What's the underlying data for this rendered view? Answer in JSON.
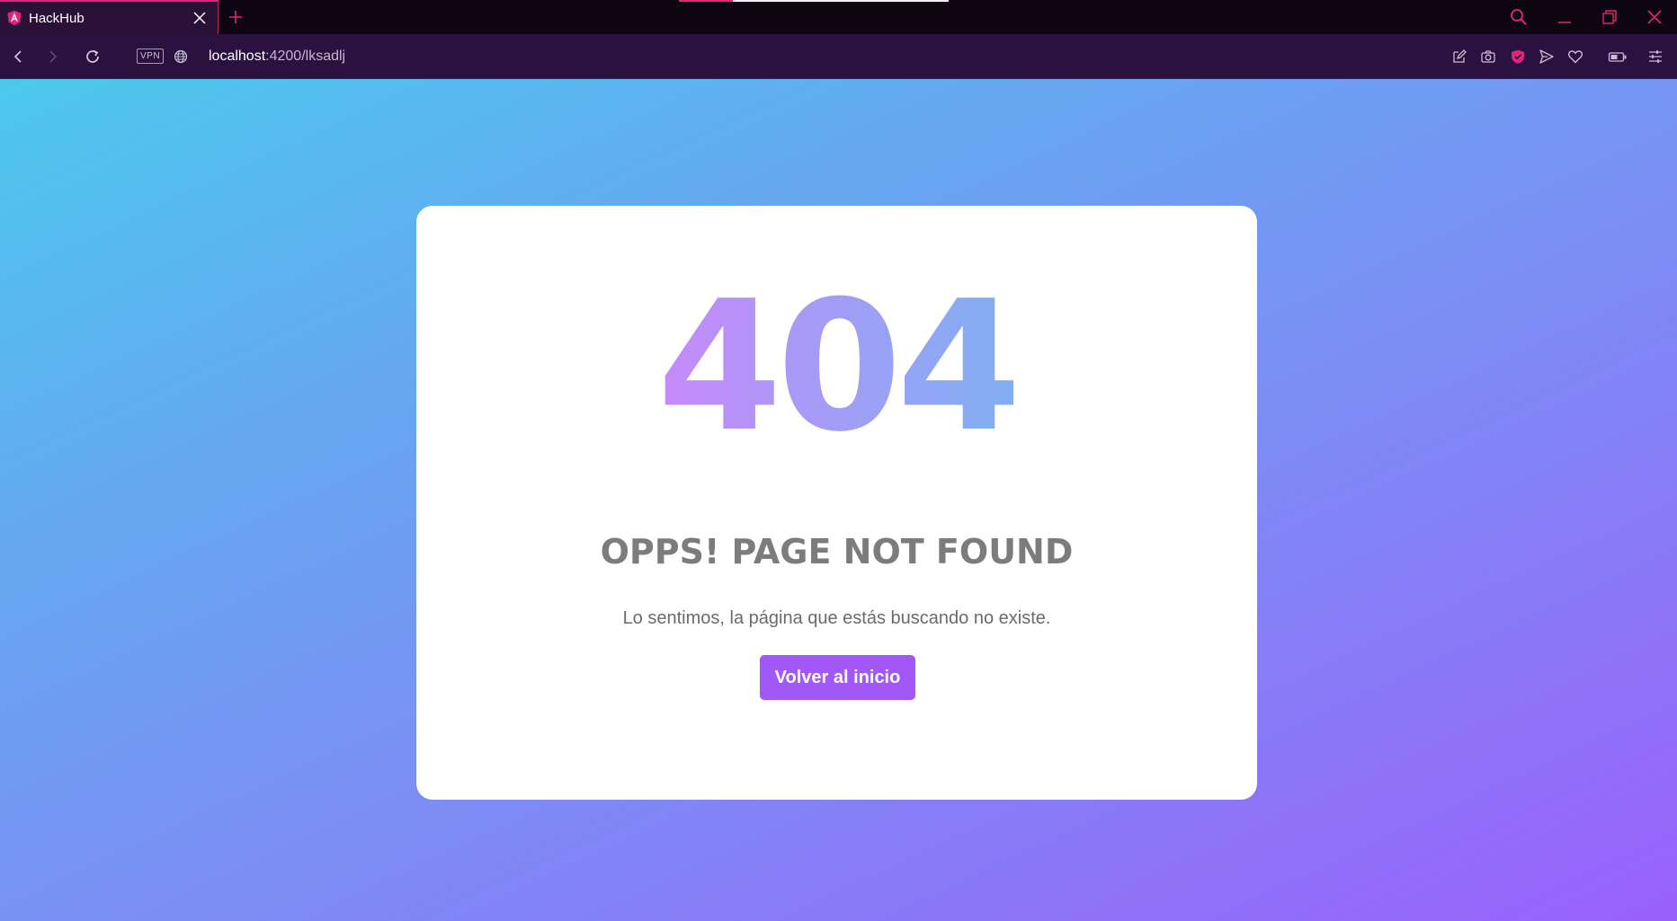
{
  "browser": {
    "tab": {
      "title": "HackHub",
      "favicon": "angular-logo-icon"
    },
    "new_tab_icon": "plus-icon",
    "window_controls": [
      "search-icon",
      "minimize-icon",
      "restore-icon",
      "close-icon"
    ],
    "address": {
      "vpn_label": "VPN",
      "url_host": "localhost",
      "url_rest": ":4200/lksadlj"
    },
    "toolbar_icons": [
      "edit-icon",
      "camera-icon",
      "shield-icon",
      "send-icon",
      "heart-icon",
      "battery-icon",
      "settings-sliders-icon"
    ]
  },
  "page": {
    "code": "404",
    "headline": "OPPS! PAGE NOT FOUND",
    "message": "Lo sentimos, la página que estás buscando no existe.",
    "button_label": "Volver al inicio"
  },
  "colors": {
    "accent": "#e0247a",
    "button": "#a258f6",
    "gradient_start": "#4cc9ee",
    "gradient_end": "#9a61fb"
  }
}
